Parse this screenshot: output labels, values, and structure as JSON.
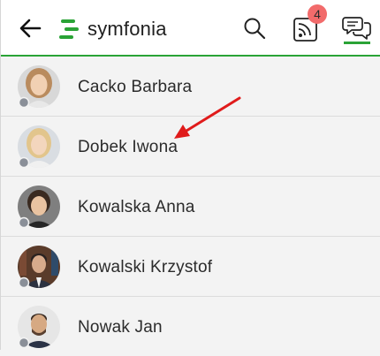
{
  "header": {
    "logo_text": "symfonia",
    "notifications_badge": "4",
    "accent_color": "#2aa336",
    "badge_color": "#f26b6b"
  },
  "contacts": [
    {
      "name": "Cacko Barbara",
      "status": "offline"
    },
    {
      "name": "Dobek Iwona",
      "status": "offline"
    },
    {
      "name": "Kowalska Anna",
      "status": "offline"
    },
    {
      "name": "Kowalski Krzystof",
      "status": "offline"
    },
    {
      "name": "Nowak Jan",
      "status": "offline"
    }
  ],
  "annotation": {
    "type": "arrow",
    "color": "#e01b1b",
    "points_to": "Dobek Iwona"
  }
}
